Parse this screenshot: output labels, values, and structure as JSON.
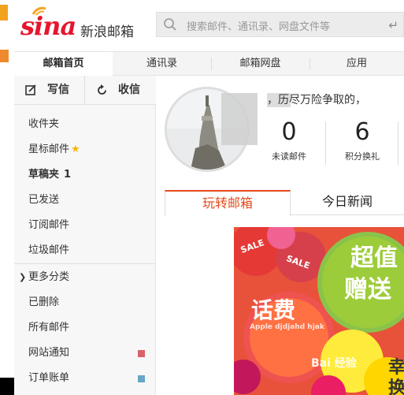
{
  "header": {
    "logo_text": "sina",
    "brand_cn": "新浪邮箱",
    "search_placeholder": "搜索邮件、通讯录、网盘文件等"
  },
  "tabs": [
    {
      "label": "邮箱首页",
      "active": true
    },
    {
      "label": "通讯录",
      "active": false
    },
    {
      "label": "邮箱网盘",
      "active": false
    },
    {
      "label": "应用",
      "active": false
    }
  ],
  "sidebar": {
    "compose_label": "写信",
    "receive_label": "收信",
    "items": [
      {
        "label": "收件夹"
      },
      {
        "label": "星标邮件"
      },
      {
        "label": "草稿夹",
        "count": "1"
      },
      {
        "label": "已发送"
      },
      {
        "label": "订阅邮件"
      },
      {
        "label": "垃圾邮件"
      },
      {
        "label": "更多分类"
      },
      {
        "label": "已删除"
      },
      {
        "label": "所有邮件"
      },
      {
        "label": "网站通知",
        "color": "#d9636b"
      },
      {
        "label": "订单账单",
        "color": "#6aa5c9"
      }
    ]
  },
  "main": {
    "greeting": "，历尽万险争取的，",
    "stats": [
      {
        "value": "0",
        "label": "未读邮件"
      },
      {
        "value": "6",
        "label": "积分换礼"
      }
    ],
    "content_tabs": [
      {
        "label": "玩转邮箱",
        "active": true
      },
      {
        "label": "今日新闻",
        "active": false
      }
    ],
    "promo": {
      "text1": "超值",
      "text2": "赠送",
      "text3": "话费",
      "text4": "幸",
      "text5": "换",
      "sale": "SALE",
      "small": "Apple djdjahd hjak",
      "watermark": "Bai 经验"
    }
  },
  "colors": {
    "brand_red": "#e6162d",
    "accent_orange": "#e64a19"
  }
}
